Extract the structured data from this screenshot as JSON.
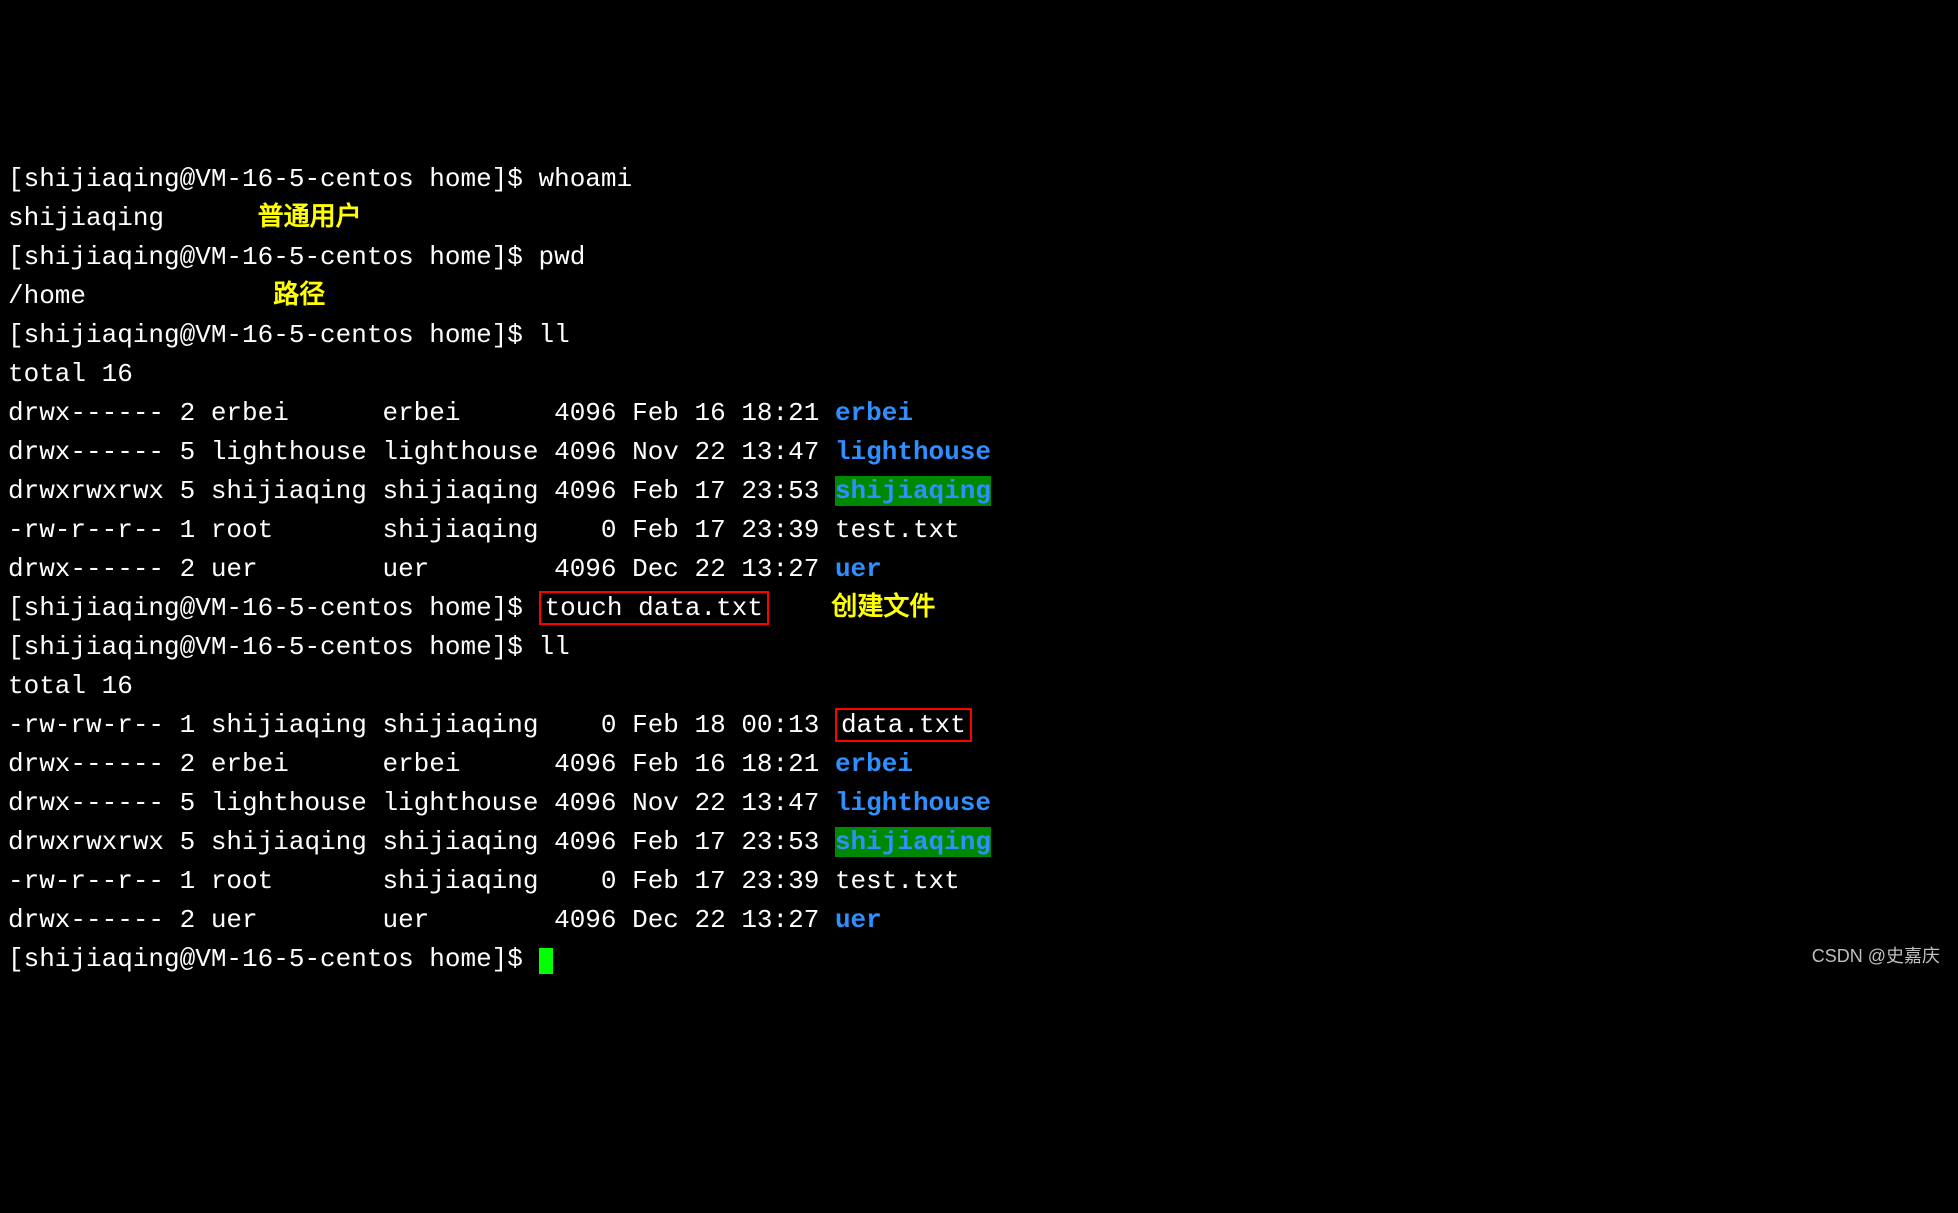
{
  "prompt": "[shijiaqing@VM-16-5-centos home]$ ",
  "cmds": {
    "whoami": "whoami",
    "pwd": "pwd",
    "ll": "ll",
    "touch": "touch data.txt"
  },
  "outputs": {
    "whoami": "shijiaqing",
    "pwd": "/home",
    "total": "total 16"
  },
  "annotations": {
    "ordinary_user": "普通用户",
    "path": "路径",
    "create_file": "创建文件"
  },
  "listing1": [
    {
      "perms": "drwx------",
      "links": "2",
      "owner": "erbei     ",
      "group": "erbei     ",
      "size": "4096",
      "date": "Feb 16 18:21",
      "name": "erbei",
      "cls": "dir-blue"
    },
    {
      "perms": "drwx------",
      "links": "5",
      "owner": "lighthouse",
      "group": "lighthouse",
      "size": "4096",
      "date": "Nov 22 13:47",
      "name": "lighthouse",
      "cls": "dir-blue"
    },
    {
      "perms": "drwxrwxrwx",
      "links": "5",
      "owner": "shijiaqing",
      "group": "shijiaqing",
      "size": "4096",
      "date": "Feb 17 23:53",
      "name": "shijiaqing",
      "cls": "dir-green-bg"
    },
    {
      "perms": "-rw-r--r--",
      "links": "1",
      "owner": "root      ",
      "group": "shijiaqing",
      "size": "   0",
      "date": "Feb 17 23:39",
      "name": "test.txt",
      "cls": ""
    },
    {
      "perms": "drwx------",
      "links": "2",
      "owner": "uer       ",
      "group": "uer       ",
      "size": "4096",
      "date": "Dec 22 13:27",
      "name": "uer",
      "cls": "dir-blue"
    }
  ],
  "listing2": [
    {
      "perms": "-rw-rw-r--",
      "links": "1",
      "owner": "shijiaqing",
      "group": "shijiaqing",
      "size": "   0",
      "date": "Feb 18 00:13",
      "name": "data.txt",
      "cls": "",
      "box": true
    },
    {
      "perms": "drwx------",
      "links": "2",
      "owner": "erbei     ",
      "group": "erbei     ",
      "size": "4096",
      "date": "Feb 16 18:21",
      "name": "erbei",
      "cls": "dir-blue"
    },
    {
      "perms": "drwx------",
      "links": "5",
      "owner": "lighthouse",
      "group": "lighthouse",
      "size": "4096",
      "date": "Nov 22 13:47",
      "name": "lighthouse",
      "cls": "dir-blue"
    },
    {
      "perms": "drwxrwxrwx",
      "links": "5",
      "owner": "shijiaqing",
      "group": "shijiaqing",
      "size": "4096",
      "date": "Feb 17 23:53",
      "name": "shijiaqing",
      "cls": "dir-green-bg"
    },
    {
      "perms": "-rw-r--r--",
      "links": "1",
      "owner": "root      ",
      "group": "shijiaqing",
      "size": "   0",
      "date": "Feb 17 23:39",
      "name": "test.txt",
      "cls": ""
    },
    {
      "perms": "drwx------",
      "links": "2",
      "owner": "uer       ",
      "group": "uer       ",
      "size": "4096",
      "date": "Dec 22 13:27",
      "name": "uer",
      "cls": "dir-blue"
    }
  ],
  "watermark": "CSDN @史嘉庆"
}
